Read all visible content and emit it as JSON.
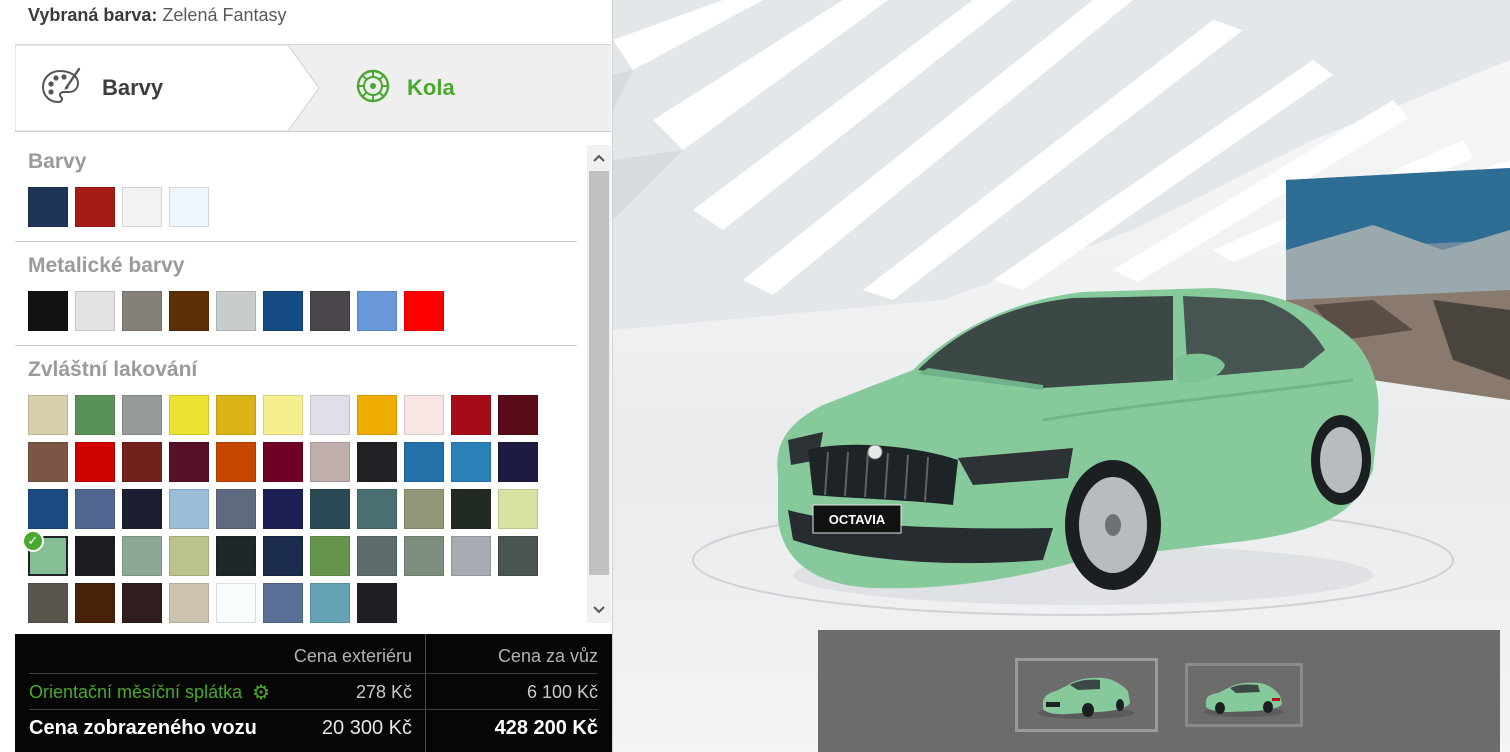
{
  "selected": {
    "label": "Vybraná barva:",
    "value": "Zelená Fantasy"
  },
  "tabs": [
    {
      "label": "Barvy",
      "icon": "palette-icon",
      "active": true
    },
    {
      "label": "Kola",
      "icon": "wheel-icon",
      "active": false
    }
  ],
  "sections": [
    {
      "title": "Barvy",
      "swatches": [
        "#1e3557",
        "#a51c16",
        "#f2f2f2",
        "#eef6fd"
      ]
    },
    {
      "title": "Metalické barvy",
      "swatches": [
        "#121212",
        "#e3e3e3",
        "#85807a",
        "#5e2f06",
        "#c9cccc",
        "#164a83",
        "#49454a",
        "#6898da",
        "#ff0000"
      ]
    },
    {
      "title": "Zvláštní lakování",
      "swatches": [
        "#d8ceac",
        "#5a9157",
        "#949b98",
        "#ece232",
        "#dcb316",
        "#f5ef8f",
        "#dedfe8",
        "#eead00",
        "#f8e6e4",
        "#a60c18",
        "#5a0b18",
        "#7d5544",
        "#cf0000",
        "#72211b",
        "#58102a",
        "#c64700",
        "#6f0023",
        "#bfaeab",
        "#202226",
        "#2470a8",
        "#2981b8",
        "#1d1c40",
        "#1a4b82",
        "#4f6691",
        "#1d1e31",
        "#9bbdd8",
        "#5f6980",
        "#1e1f55",
        "#2b4a55",
        "#4a6f73",
        "#8f9778",
        "#222b22",
        "#d8e0a2",
        "#86bf96",
        "#1b1d22",
        "#8da995",
        "#b9c38a",
        "#1f2628",
        "#1c2c4c",
        "#67944b",
        "#5c6d6c",
        "#7d8e7f",
        "#a6abb1",
        "#4a5551",
        "#59564e",
        "#47210a",
        "#2f1e1d",
        "#ccc4b0",
        "#f6fdfc",
        "#5b7096",
        "#66a2b6",
        "#1f2026"
      ],
      "selected_index": 33
    }
  ],
  "prices": {
    "col_exterior": "Cena exteriéru",
    "col_car": "Cena za vůz",
    "monthly_label": "Orientační měsíční splátka",
    "monthly_exterior": "278 Kč",
    "monthly_car": "6 100 Kč",
    "shown_label": "Cena zobrazeného vozu",
    "shown_exterior": "20 300 Kč",
    "shown_car": "428 200 Kč"
  },
  "car": {
    "color": "#86c99a",
    "plate": "OCTAVIA"
  },
  "thumbnails": [
    "front-three-quarter-view",
    "rear-three-quarter-view"
  ]
}
